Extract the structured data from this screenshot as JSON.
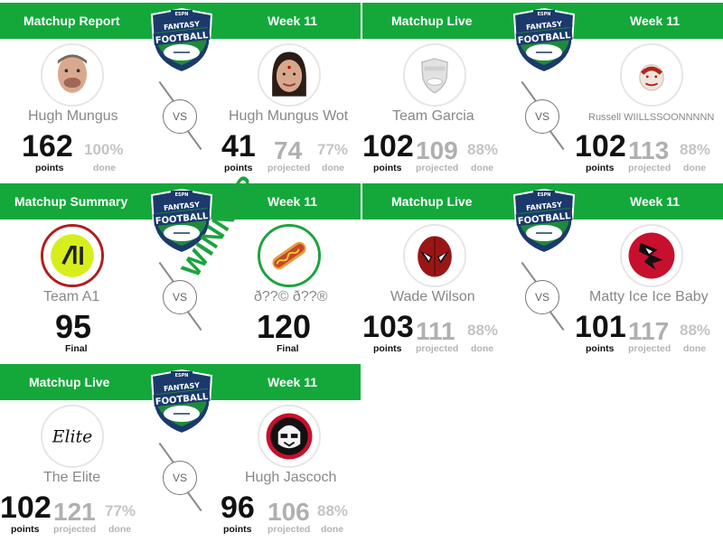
{
  "colors": {
    "banner": "#14a83b",
    "winner": "#1da33d",
    "loser_ring": "#b01e1e"
  },
  "cards": [
    {
      "header_left": "Matchup Report",
      "header_right": "Week 11",
      "vs": "VS",
      "left": {
        "name": "Hugh Mungus",
        "score": "162",
        "score_label": "points",
        "pct": "100%",
        "pct_label": "done"
      },
      "right": {
        "name": "Hugh Mungus Wot",
        "score": "41",
        "score_label": "points",
        "projected": "74",
        "projected_label": "projected",
        "pct": "77%",
        "pct_label": "done"
      }
    },
    {
      "header_left": "Matchup Live",
      "header_right": "Week 11",
      "vs": "VS",
      "left": {
        "name": "Team Garcia",
        "score": "102",
        "score_label": "points",
        "projected": "109",
        "projected_label": "projected",
        "pct": "88%",
        "pct_label": "done"
      },
      "right": {
        "name": "Russell WIILLSSOONNNNN",
        "score": "102",
        "score_label": "points",
        "projected": "113",
        "projected_label": "projected",
        "pct": "88%",
        "pct_label": "done"
      }
    },
    {
      "header_left": "Matchup Summary",
      "header_right": "Week 11",
      "vs": "VS",
      "winner_text": "WINNER",
      "left": {
        "name": "Team A1",
        "score": "95",
        "score_label": "Final"
      },
      "right": {
        "name": "ð??© ð??®",
        "score": "120",
        "score_label": "Final"
      }
    },
    {
      "header_left": "Matchup Live",
      "header_right": "Week 11",
      "vs": "VS",
      "left": {
        "name": "Wade Wilson",
        "score": "103",
        "score_label": "points",
        "projected": "111",
        "projected_label": "projected",
        "pct": "88%",
        "pct_label": "done"
      },
      "right": {
        "name": "Matty Ice Ice Baby",
        "score": "101",
        "score_label": "points",
        "projected": "117",
        "projected_label": "projected",
        "pct": "88%",
        "pct_label": "done"
      }
    },
    {
      "header_left": "Matchup Live",
      "header_right": "Week 11",
      "vs": "VS",
      "left": {
        "name": "The Elite",
        "avatar_text": "Elite",
        "score": "102",
        "score_label": "points",
        "projected": "121",
        "projected_label": "projected",
        "pct": "77%",
        "pct_label": "done"
      },
      "right": {
        "name": "Hugh Jascoch",
        "score": "96",
        "score_label": "points",
        "projected": "106",
        "projected_label": "projected",
        "pct": "88%",
        "pct_label": "done"
      }
    }
  ],
  "logo": {
    "brand": "ESPN",
    "line1": "FANTASY",
    "line2": "FOOTBALL"
  }
}
